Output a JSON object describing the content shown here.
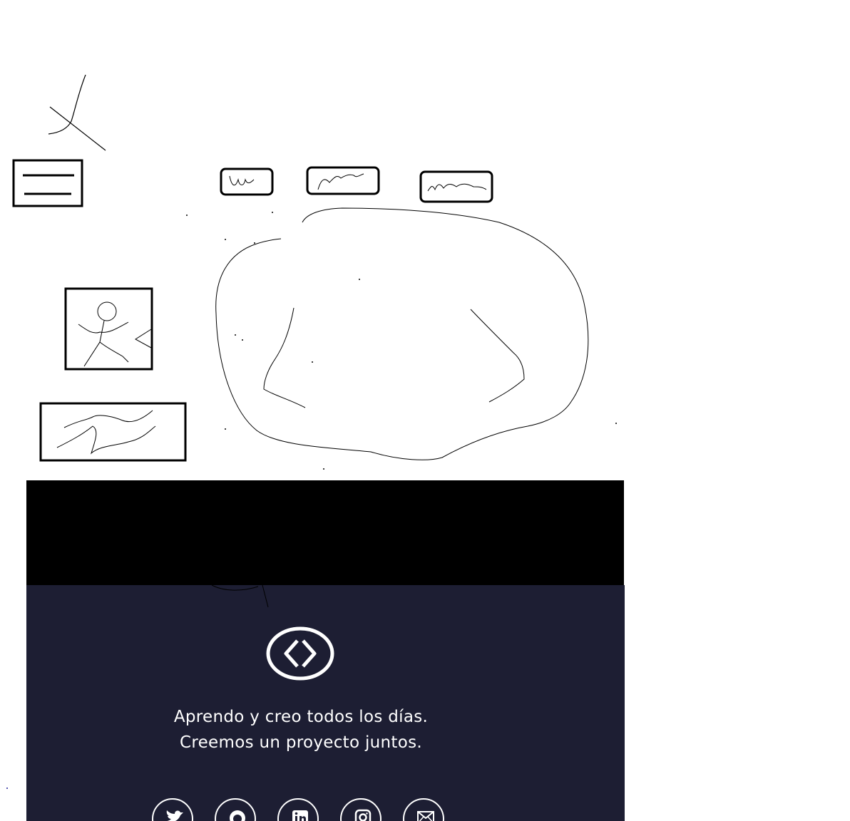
{
  "footer": {
    "tagline_line1": "Aprendo y creo todos los días.",
    "tagline_line2": "Creemos un proyecto juntos.",
    "logo_icon": "code-brackets-icon",
    "socials": [
      {
        "name": "twitter",
        "icon": "twitter-icon"
      },
      {
        "name": "github",
        "icon": "github-icon"
      },
      {
        "name": "linkedin",
        "icon": "linkedin-icon"
      },
      {
        "name": "instagram",
        "icon": "instagram-icon"
      },
      {
        "name": "email",
        "icon": "mail-icon"
      }
    ]
  },
  "colors": {
    "footer_bg": "#1d1e33",
    "band": "#000000",
    "text": "#ffffff"
  }
}
